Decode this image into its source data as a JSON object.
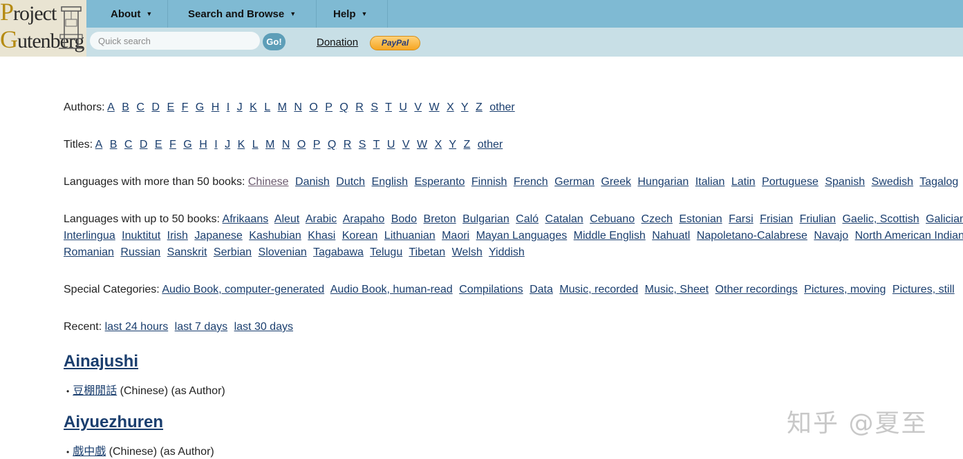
{
  "logo": {
    "line1_cap": "P",
    "line1_rest": "roject",
    "line2_cap": "G",
    "line2_rest": "utenberg"
  },
  "menu": [
    {
      "label": "About"
    },
    {
      "label": "Search and Browse"
    },
    {
      "label": "Help"
    }
  ],
  "search": {
    "placeholder": "Quick search",
    "go_label": "Go!"
  },
  "donation": {
    "label": "Donation",
    "paypal_label": "PayPal"
  },
  "authors_index": {
    "label": "Authors:",
    "letters": [
      "A",
      "B",
      "C",
      "D",
      "E",
      "F",
      "G",
      "H",
      "I",
      "J",
      "K",
      "L",
      "M",
      "N",
      "O",
      "P",
      "Q",
      "R",
      "S",
      "T",
      "U",
      "V",
      "W",
      "X",
      "Y",
      "Z",
      "other"
    ]
  },
  "titles_index": {
    "label": "Titles:",
    "letters": [
      "A",
      "B",
      "C",
      "D",
      "E",
      "F",
      "G",
      "H",
      "I",
      "J",
      "K",
      "L",
      "M",
      "N",
      "O",
      "P",
      "Q",
      "R",
      "S",
      "T",
      "U",
      "V",
      "W",
      "X",
      "Y",
      "Z",
      "other"
    ]
  },
  "languages_major": {
    "label": "Languages with more than 50 books:",
    "items": [
      "Chinese",
      "Danish",
      "Dutch",
      "English",
      "Esperanto",
      "Finnish",
      "French",
      "German",
      "Greek",
      "Hungarian",
      "Italian",
      "Latin",
      "Portuguese",
      "Spanish",
      "Swedish",
      "Tagalog"
    ]
  },
  "languages_minor": {
    "label": "Languages with up to 50 books:",
    "line1": [
      "Afrikaans",
      "Aleut",
      "Arabic",
      "Arapaho",
      "Bodo",
      "Breton",
      "Bulgarian",
      "Caló",
      "Catalan",
      "Cebuano",
      "Czech",
      "Estonian",
      "Farsi",
      "Frisian",
      "Friulian",
      "Gaelic, Scottish",
      "Galician"
    ],
    "line2": [
      "Interlingua",
      "Inuktitut",
      "Irish",
      "Japanese",
      "Kashubian",
      "Khasi",
      "Korean",
      "Lithuanian",
      "Maori",
      "Mayan Languages",
      "Middle English",
      "Nahuatl",
      "Napoletano-Calabrese",
      "Navajo",
      "North American Indian"
    ],
    "line3": [
      "Romanian",
      "Russian",
      "Sanskrit",
      "Serbian",
      "Slovenian",
      "Tagabawa",
      "Telugu",
      "Tibetan",
      "Welsh",
      "Yiddish"
    ]
  },
  "special": {
    "label": "Special Categories:",
    "items": [
      "Audio Book, computer-generated",
      "Audio Book, human-read",
      "Compilations",
      "Data",
      "Music, recorded",
      "Music, Sheet",
      "Other recordings",
      "Pictures, moving",
      "Pictures, still"
    ]
  },
  "recent": {
    "label": "Recent:",
    "items": [
      "last 24 hours",
      "last 7 days",
      "last 30 days"
    ]
  },
  "authors": [
    {
      "name": "Ainajushi",
      "work_title": "豆棚閒話",
      "work_meta": "(Chinese) (as Author)"
    },
    {
      "name": "Aiyuezhuren",
      "work_title": "戲中戲",
      "work_meta": "(Chinese) (as Author)"
    }
  ],
  "watermark": "知乎 @夏至",
  "colors": {
    "topbar": "#7fbad3",
    "subbar": "#c8dfe6",
    "link": "#1a3e6e",
    "visited": "#6b5a6e"
  }
}
